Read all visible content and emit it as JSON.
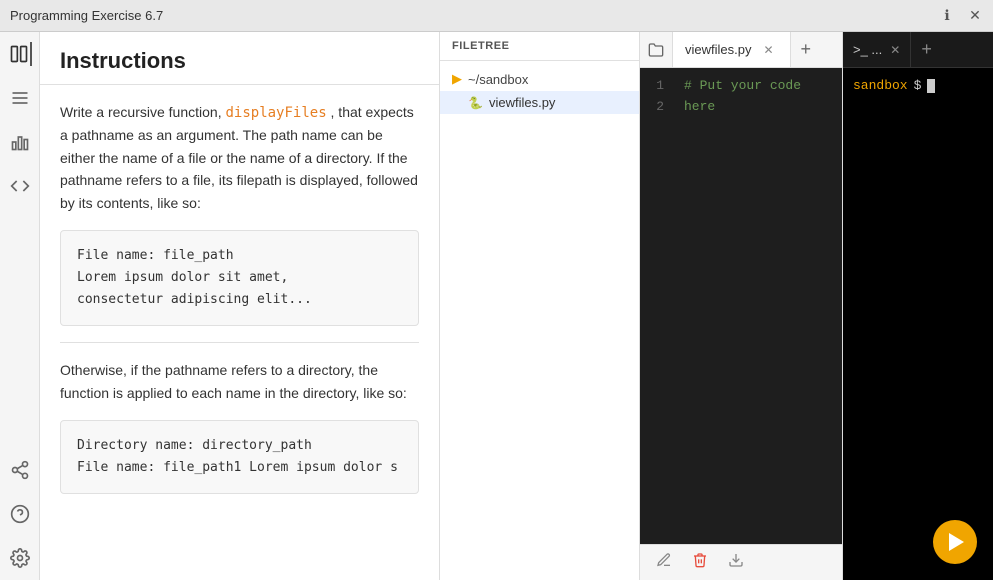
{
  "titlebar": {
    "title": "Programming Exercise 6.7",
    "info_icon": "ℹ",
    "close_icon": "✕"
  },
  "sidebar": {
    "icons": [
      {
        "name": "book-icon",
        "symbol": "📖",
        "active": true
      },
      {
        "name": "list-icon",
        "symbol": "≡"
      },
      {
        "name": "chart-icon",
        "symbol": "📊"
      },
      {
        "name": "code-icon",
        "symbol": "</>"
      }
    ],
    "bottom_icons": [
      {
        "name": "share-icon",
        "symbol": "⇄"
      },
      {
        "name": "help-icon",
        "symbol": "?"
      },
      {
        "name": "settings-icon",
        "symbol": "⚙"
      }
    ]
  },
  "instructions": {
    "title": "Instructions",
    "paragraph1": "Write a recursive function, ",
    "function_name": "displayFiles",
    "paragraph1b": " , that expects a pathname as an argument. The path name can be either the name of a file or the name of a directory. If the pathname refers to a file, its filepath is displayed, followed by its contents, like so:",
    "code_block1_line1": "File name: file_path",
    "code_block1_line2": "Lorem ipsum dolor sit amet,",
    "code_block1_line3": "consectetur adipiscing elit...",
    "paragraph2": "Otherwise, if the pathname refers to a directory, the function is applied to each name in the directory, like so:",
    "code_block2_line1": "Directory name: directory_path",
    "code_block2_line2": "File name: file_path1 Lorem ipsum dolor s"
  },
  "filetree": {
    "header": "FILETREE",
    "folder": "~/sandbox",
    "files": [
      {
        "name": "viewfiles.py",
        "icon": "🐍"
      }
    ]
  },
  "editor": {
    "tab_icon": "📁",
    "tab_name": "viewfiles.py",
    "tab_close": "✕",
    "tab_add": "+",
    "line1": "# Put your code here",
    "line2": "",
    "footer_icons": [
      {
        "name": "pencil-icon",
        "symbol": "✏",
        "class": ""
      },
      {
        "name": "trash-icon",
        "symbol": "🗑",
        "class": "delete"
      },
      {
        "name": "download-icon",
        "symbol": "⬇",
        "class": ""
      }
    ]
  },
  "terminal": {
    "tab_label": ">_ ...",
    "tab_close": "✕",
    "tab_add": "+",
    "sandbox_label": "sandbox",
    "dollar_sign": "$",
    "run_button_label": "Run"
  }
}
